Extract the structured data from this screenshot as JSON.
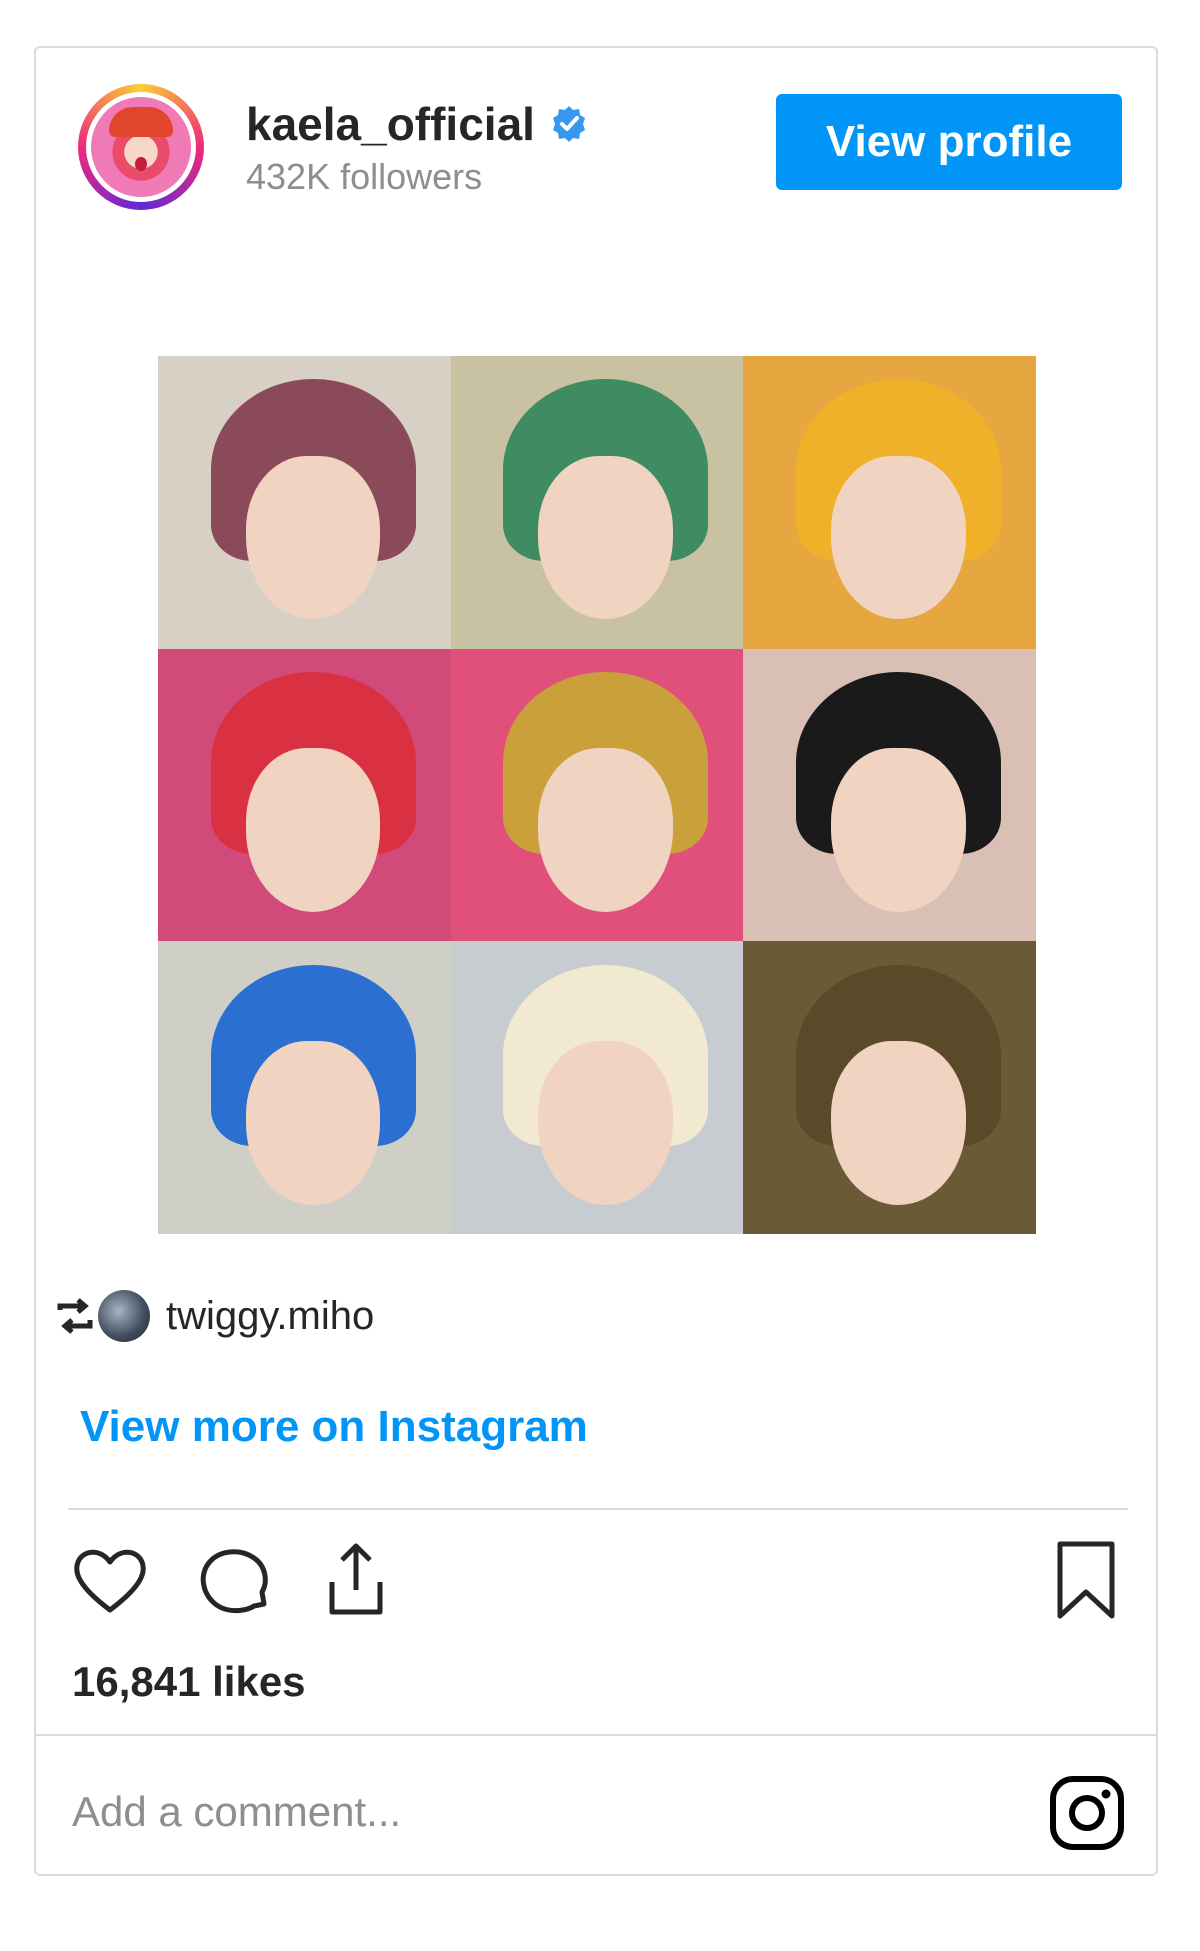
{
  "header": {
    "username": "kaela_official",
    "followers": "432K followers",
    "view_profile_label": "View profile",
    "verified_icon": "verified-badge-icon"
  },
  "media": {
    "tiles": [
      {
        "hair": "#8b4a5a",
        "bg": "#d8d0c4"
      },
      {
        "hair": "#3f8c62",
        "bg": "#c8c2a2"
      },
      {
        "hair": "#f0b02a",
        "bg": "#e6a640"
      },
      {
        "hair": "#d93042",
        "bg": "#d14a7a"
      },
      {
        "hair": "#c9a03a",
        "bg": "#e0507a"
      },
      {
        "hair": "#1a1a1a",
        "bg": "#d9bfb4"
      },
      {
        "hair": "#2b6fd1",
        "bg": "#cfcfc8"
      },
      {
        "hair": "#f2ead0",
        "bg": "#c6ccd0"
      },
      {
        "hair": "#5a4a2a",
        "bg": "#6a5a36"
      }
    ]
  },
  "repost": {
    "icon": "repost-icon",
    "username": "twiggy.miho"
  },
  "view_more_label": "View more on Instagram",
  "actions": {
    "like_icon": "heart-icon",
    "comment_icon": "comment-icon",
    "share_icon": "share-icon",
    "save_icon": "bookmark-icon"
  },
  "likes": "16,841 likes",
  "comment_placeholder": "Add a comment...",
  "colors": {
    "accent": "#0095f6",
    "border": "#dbdbdb",
    "muted": "#8e8e8e"
  }
}
